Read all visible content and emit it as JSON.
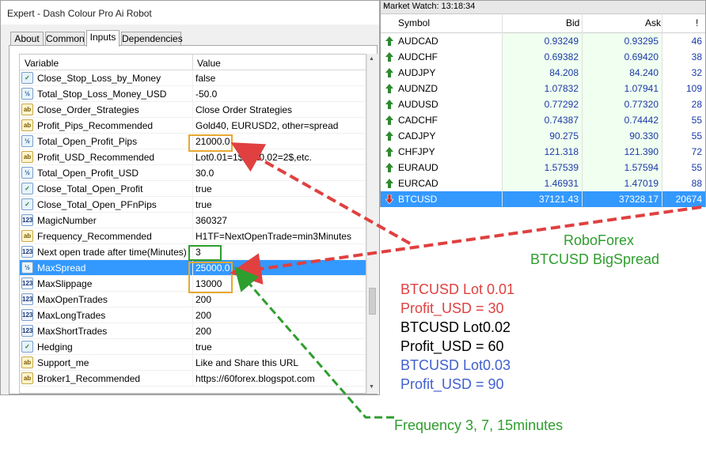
{
  "dialog": {
    "title": "Expert - Dash Colour Pro Ai Robot",
    "tabs": [
      {
        "label": "About",
        "active": false
      },
      {
        "label": "Common",
        "active": false
      },
      {
        "label": "Inputs",
        "active": true
      },
      {
        "label": "Dependencies",
        "active": false
      }
    ],
    "columns": {
      "variable": "Variable",
      "value": "Value"
    },
    "params": [
      {
        "icon": "bool",
        "name": "Close_Stop_Loss_by_Money",
        "value": "false"
      },
      {
        "icon": "dbl",
        "name": "Total_Stop_Loss_Money_USD",
        "value": "-50.0"
      },
      {
        "icon": "str",
        "name": "Close_Order_Strategies",
        "value": "Close Order Strategies"
      },
      {
        "icon": "str",
        "name": "Profit_Pips_Recommended",
        "value": "Gold40, EURUSD2, other=spread"
      },
      {
        "icon": "dbl",
        "name": "Total_Open_Profit_Pips",
        "value": "21000.0"
      },
      {
        "icon": "str",
        "name": "Profit_USD_Recommended",
        "value": "Lot0.01=1$,Lot0.02=2$,etc."
      },
      {
        "icon": "dbl",
        "name": "Total_Open_Profit_USD",
        "value": "30.0"
      },
      {
        "icon": "bool",
        "name": "Close_Total_Open_Profit",
        "value": "true"
      },
      {
        "icon": "bool",
        "name": "Close_Total_Open_PFnPips",
        "value": "true"
      },
      {
        "icon": "int",
        "name": "MagicNumber",
        "value": "360327"
      },
      {
        "icon": "str",
        "name": "Frequency_Recommended",
        "value": "H1TF=NextOpenTrade=min3Minutes"
      },
      {
        "icon": "int",
        "name": "Next open trade after time(Minutes)",
        "value": "3"
      },
      {
        "icon": "dbl",
        "name": "MaxSpread",
        "value": "25000.0",
        "selected": true
      },
      {
        "icon": "int",
        "name": "MaxSlippage",
        "value": "13000"
      },
      {
        "icon": "int",
        "name": "MaxOpenTrades",
        "value": "200"
      },
      {
        "icon": "int",
        "name": "MaxLongTrades",
        "value": "200"
      },
      {
        "icon": "int",
        "name": "MaxShortTrades",
        "value": "200"
      },
      {
        "icon": "bool",
        "name": "Hedging",
        "value": "true"
      },
      {
        "icon": "str",
        "name": "Support_me",
        "value": "Like and Share this URL"
      },
      {
        "icon": "str",
        "name": "Broker1_Recommended",
        "value": "https://60forex.blogspot.com"
      }
    ],
    "icon_text": {
      "bool": "✓",
      "dbl": "½",
      "str": "ab",
      "int": "123"
    }
  },
  "market_watch": {
    "title": "Market Watch: 13:18:34",
    "close_glyph": "×",
    "columns": {
      "symbol": "Symbol",
      "bid": "Bid",
      "ask": "Ask",
      "spread": "!"
    },
    "rows": [
      {
        "symbol": "AUDCAD",
        "bid": "0.93249",
        "ask": "0.93295",
        "spread": "46",
        "dir": "up"
      },
      {
        "symbol": "AUDCHF",
        "bid": "0.69382",
        "ask": "0.69420",
        "spread": "38",
        "dir": "up"
      },
      {
        "symbol": "AUDJPY",
        "bid": "84.208",
        "ask": "84.240",
        "spread": "32",
        "dir": "up"
      },
      {
        "symbol": "AUDNZD",
        "bid": "1.07832",
        "ask": "1.07941",
        "spread": "109",
        "dir": "up"
      },
      {
        "symbol": "AUDUSD",
        "bid": "0.77292",
        "ask": "0.77320",
        "spread": "28",
        "dir": "up"
      },
      {
        "symbol": "CADCHF",
        "bid": "0.74387",
        "ask": "0.74442",
        "spread": "55",
        "dir": "up"
      },
      {
        "symbol": "CADJPY",
        "bid": "90.275",
        "ask": "90.330",
        "spread": "55",
        "dir": "up"
      },
      {
        "symbol": "CHFJPY",
        "bid": "121.318",
        "ask": "121.390",
        "spread": "72",
        "dir": "up"
      },
      {
        "symbol": "EURAUD",
        "bid": "1.57539",
        "ask": "1.57594",
        "spread": "55",
        "dir": "up"
      },
      {
        "symbol": "EURCAD",
        "bid": "1.46931",
        "ask": "1.47019",
        "spread": "88",
        "dir": "up"
      },
      {
        "symbol": "BTCUSD",
        "bid": "37121.43",
        "ask": "37328.17",
        "spread": "20674",
        "dir": "down",
        "selected": true
      }
    ]
  },
  "annotations": {
    "broker": "RoboForex",
    "broker_note": "BTCUSD BigSpread",
    "lines": [
      {
        "text": "BTCUSD Lot 0.01",
        "color": "#e04040"
      },
      {
        "text": "Profit_USD = 30",
        "color": "#e04040"
      },
      {
        "text": "BTCUSD Lot0.02",
        "color": "#000000"
      },
      {
        "text": "Profit_USD = 60",
        "color": "#000000"
      },
      {
        "text": "BTCUSD Lot0.03",
        "color": "#4060d0"
      },
      {
        "text": "Profit_USD = 90",
        "color": "#4060d0"
      }
    ],
    "frequency": "Frequency 3, 7, 15minutes",
    "green": "#2e9e2e",
    "red": "#e04040"
  }
}
